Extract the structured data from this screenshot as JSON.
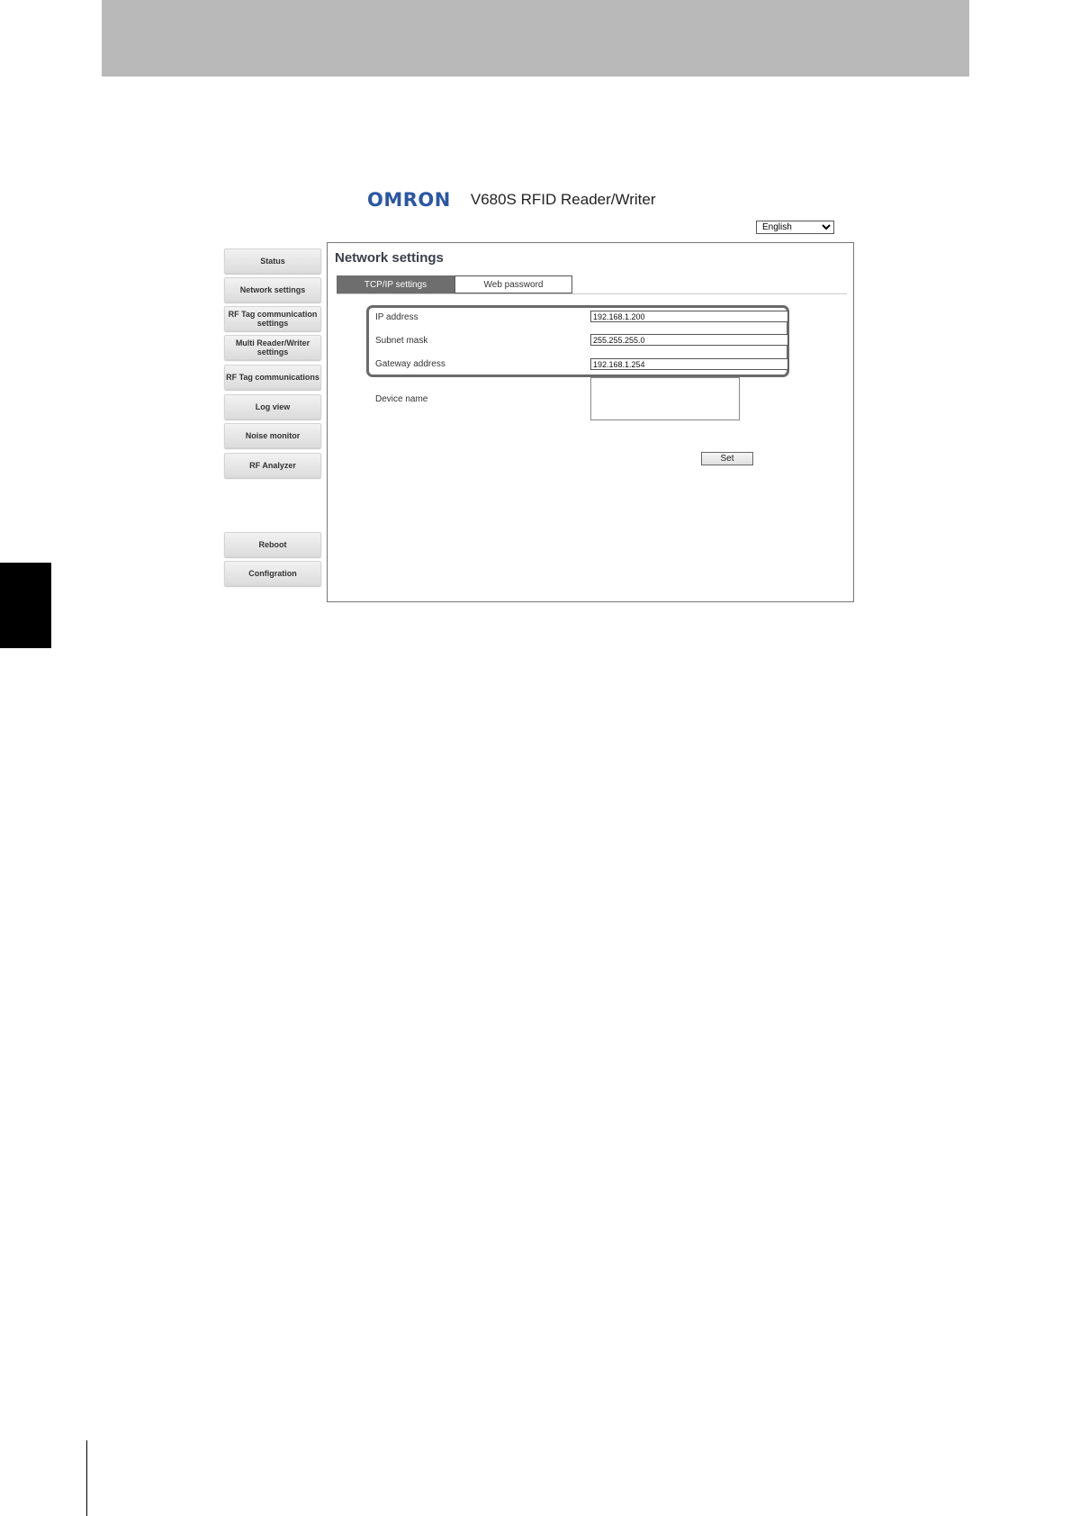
{
  "header": {
    "logo_text": "OMRON",
    "product_title": "V680S RFID Reader/Writer"
  },
  "language": {
    "selected": "English",
    "options": [
      "English"
    ]
  },
  "nav": {
    "items": [
      {
        "label": "Status"
      },
      {
        "label": "Network settings"
      },
      {
        "label": "RF Tag communication\nsettings"
      },
      {
        "label": "Multi Reader/Writer\nsettings"
      },
      {
        "label": "RF Tag communications"
      },
      {
        "label": "Log view"
      },
      {
        "label": "Noise monitor"
      },
      {
        "label": "RF Analyzer"
      },
      {
        "label": "Reboot"
      },
      {
        "label": "Configration"
      }
    ]
  },
  "panel": {
    "title": "Network settings",
    "tabs": [
      {
        "label": "TCP/IP settings",
        "active": true
      },
      {
        "label": "Web password",
        "active": false
      }
    ],
    "fields": {
      "ip_label": "IP address",
      "ip_value": "192.168.1.200",
      "subnet_label": "Subnet mask",
      "subnet_value": "255.255.255.0",
      "gateway_label": "Gateway address",
      "gateway_value": "192.168.1.254",
      "device_label": "Device name",
      "device_value": ""
    },
    "set_label": "Set"
  },
  "colors": {
    "logo_blue": "#2a56a6",
    "active_tab": "#6e6e6e",
    "top_band": "#b9b9b9"
  }
}
